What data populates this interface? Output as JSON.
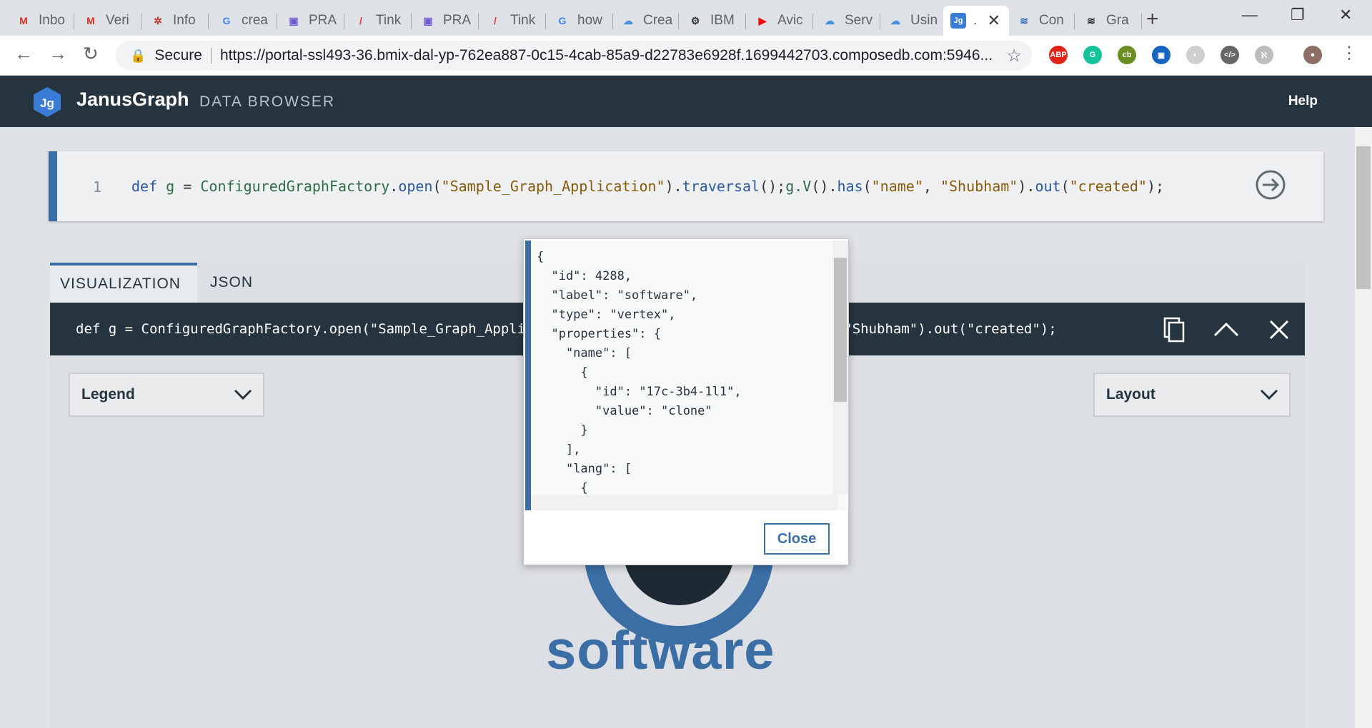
{
  "browser": {
    "tabs": [
      {
        "label": "Inbo",
        "icon": "gmail-icon",
        "color": "#d93025",
        "glyph": "M"
      },
      {
        "label": "Veri",
        "icon": "gmail-icon",
        "color": "#d93025",
        "glyph": "M"
      },
      {
        "label": "Info",
        "icon": "gear-red-icon",
        "color": "#c0392b",
        "glyph": "✲"
      },
      {
        "label": "crea",
        "icon": "google-icon",
        "color": "#4285f4",
        "glyph": "G"
      },
      {
        "label": "PRA",
        "icon": "box-icon",
        "color": "#6a5acd",
        "glyph": "▣"
      },
      {
        "label": "Tink",
        "icon": "pen-icon",
        "color": "#e53935",
        "glyph": "/"
      },
      {
        "label": "PRA",
        "icon": "box-icon",
        "color": "#6a5acd",
        "glyph": "▣"
      },
      {
        "label": "Tink",
        "icon": "pen-icon",
        "color": "#e53935",
        "glyph": "/"
      },
      {
        "label": "how",
        "icon": "google-icon",
        "color": "#4285f4",
        "glyph": "G"
      },
      {
        "label": "Crea",
        "icon": "cloud-icon",
        "color": "#4a90d9",
        "glyph": "☁"
      },
      {
        "label": "IBM",
        "icon": "bee-icon",
        "color": "#333333",
        "glyph": "⚙"
      },
      {
        "label": "Avic",
        "icon": "youtube-icon",
        "color": "#ff0000",
        "glyph": "▶"
      },
      {
        "label": "Serv",
        "icon": "cloud-icon",
        "color": "#4a90d9",
        "glyph": "☁"
      },
      {
        "label": "Usin",
        "icon": "cloud-icon",
        "color": "#4a90d9",
        "glyph": "☁"
      },
      {
        "label": ".",
        "icon": "janusgraph-icon",
        "color": "#3a7bd5",
        "glyph": "Jg"
      },
      {
        "label": "Con",
        "icon": "compose-icon",
        "color": "#2f6cb3",
        "glyph": "≋"
      },
      {
        "label": "Gra",
        "icon": "graph-icon",
        "color": "#222222",
        "glyph": "≋"
      }
    ],
    "secure_label": "Secure",
    "url": "https://portal-ssl493-36.bmix-dal-yp-762ea887-0c15-4cab-85a9-d22783e6928f.1699442703.composedb.com:5946...",
    "extensions": [
      {
        "name": "adblock-icon",
        "label": "ABP",
        "color": "#e2231a"
      },
      {
        "name": "grammarly-icon",
        "label": "G",
        "color": "#15c39a"
      },
      {
        "name": "cb-icon",
        "label": "cb",
        "color": "#6b8e23"
      },
      {
        "name": "train-icon",
        "label": "▣",
        "color": "#1565c0"
      },
      {
        "name": "circle-ext-icon",
        "label": "◐",
        "color": "#cfcfcf"
      },
      {
        "name": "code-icon",
        "label": "</>",
        "color": "#666666"
      },
      {
        "name": "puzzle-icon",
        "label": "ℵ",
        "color": "#bdbdbd"
      }
    ]
  },
  "app": {
    "logo_text": "Jg",
    "brand": "JanusGraph",
    "subtitle": "DATA BROWSER",
    "help_label": "Help"
  },
  "editor": {
    "line_number": "1",
    "tokens": {
      "def": "def",
      "g": "g",
      "eq": "=",
      "factory": "ConfiguredGraphFactory",
      "dot1": ".",
      "open": "open",
      "paren1": "(",
      "graph_name": "\"Sample_Graph_Application\"",
      "paren2": ").",
      "traversal": "traversal",
      "semi": "();",
      "gv": "g.V",
      "paren3": "().",
      "has": "has",
      "paren4": "(",
      "name_key": "\"name\"",
      "comma": ", ",
      "name_val": "\"Shubham\"",
      "paren5": ").",
      "out": "out",
      "paren6": "(",
      "created": "\"created\"",
      "end": ");"
    }
  },
  "result": {
    "tabs": [
      "VISUALIZATION",
      "JSON"
    ],
    "query_text": "def g = ConfiguredGraphFactory.open(\"Sample_Graph_Application\").traversal();g.V().has(\"name\", \"Shubham\").out(\"created\");",
    "legend_label": "Legend",
    "layout_label": "Layout",
    "node_label": "software"
  },
  "modal": {
    "json_lines": [
      "{",
      "  \"id\": 4288,",
      "  \"label\": \"software\",",
      "  \"type\": \"vertex\",",
      "  \"properties\": {",
      "    \"name\": [",
      "      {",
      "        \"id\": \"17c-3b4-1l1\",",
      "        \"value\": \"clone\"",
      "      }",
      "    ],",
      "    \"lang\": [",
      "      {"
    ],
    "close_label": "Close"
  }
}
